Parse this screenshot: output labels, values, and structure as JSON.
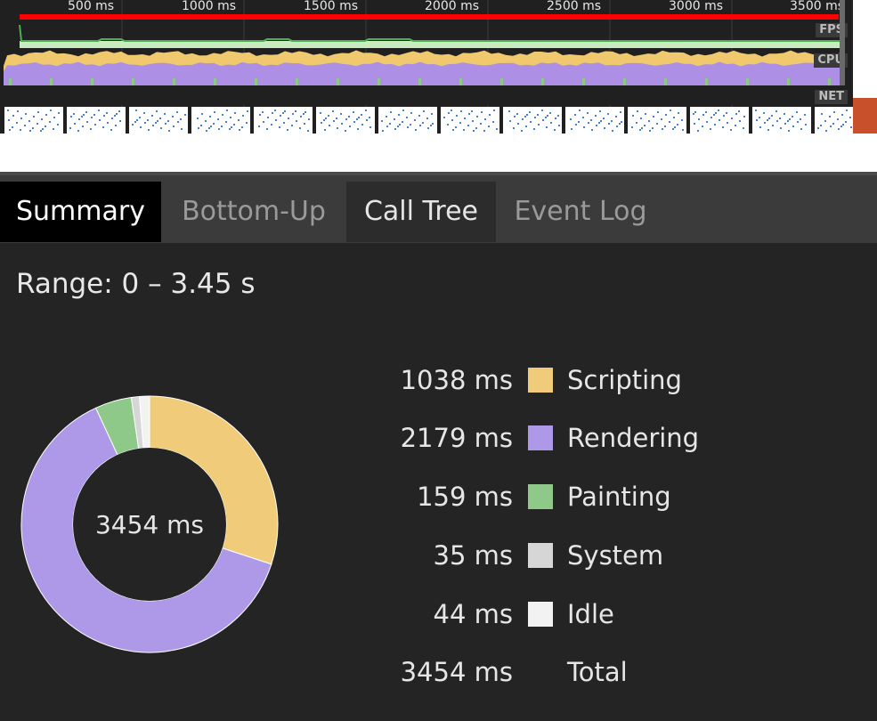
{
  "overview": {
    "ruler_labels": [
      "500 ms",
      "1000 ms",
      "1500 ms",
      "2000 ms",
      "2500 ms",
      "3000 ms",
      "3500 ms"
    ],
    "tracks": {
      "fps": "FPS",
      "cpu": "CPU",
      "net": "NET"
    },
    "colors": {
      "fps_line": "#4caf50",
      "fps_fill": "#c8ecc0",
      "scripting": "#f0c86e",
      "rendering": "#ad8fe6",
      "painting": "#8fc98a",
      "selection_bar": "#ff0000"
    }
  },
  "tabs": [
    {
      "label": "Summary",
      "state": "active"
    },
    {
      "label": "Bottom-Up",
      "state": "inactive"
    },
    {
      "label": "Call Tree",
      "state": "hover"
    },
    {
      "label": "Event Log",
      "state": "inactive"
    }
  ],
  "summary": {
    "range_label": "Range: 0 – 3.45 s",
    "total_center": "3454 ms",
    "legend": [
      {
        "value": "1038 ms",
        "label": "Scripting",
        "color": "#f0cc7a"
      },
      {
        "value": "2179 ms",
        "label": "Rendering",
        "color": "#ae98e8"
      },
      {
        "value": "159 ms",
        "label": "Painting",
        "color": "#8fc98a"
      },
      {
        "value": "35 ms",
        "label": "System",
        "color": "#d6d6d6"
      },
      {
        "value": "44 ms",
        "label": "Idle",
        "color": "#f2f2f2"
      },
      {
        "value": "3454 ms",
        "label": "Total",
        "color": ""
      }
    ]
  },
  "chart_data": {
    "type": "pie",
    "categories": [
      "Scripting",
      "Rendering",
      "Painting",
      "System",
      "Idle"
    ],
    "values": [
      1038,
      2179,
      159,
      35,
      44
    ],
    "colors": [
      "#f0cc7a",
      "#ae98e8",
      "#8fc98a",
      "#d6d6d6",
      "#f2f2f2"
    ],
    "total": 3454,
    "unit": "ms"
  }
}
